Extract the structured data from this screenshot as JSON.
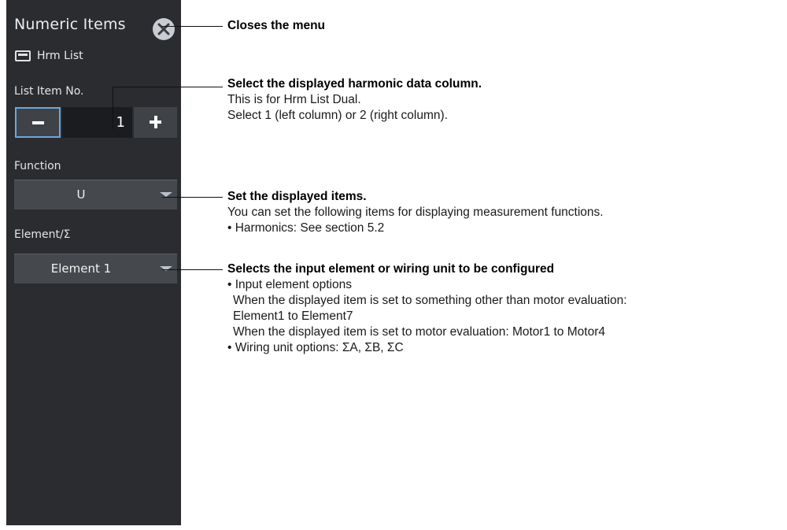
{
  "panel": {
    "title": "Numeric Items",
    "mode_label": "Hrm List",
    "list_item_label": "List Item No.",
    "list_item_value": "1",
    "function_label": "Function",
    "function_value": "U",
    "element_label": "Element/Σ",
    "element_value": "Element 1"
  },
  "annotations": {
    "close": {
      "heading": "Closes the menu"
    },
    "list_item": {
      "heading": "Select the displayed harmonic data column.",
      "lines": [
        "This is for Hrm List Dual.",
        "Select 1 (left column) or 2 (right column)."
      ]
    },
    "function": {
      "heading": "Set the displayed items.",
      "lines": [
        "You can set the following items for displaying measurement functions.",
        "• Harmonics: See section 5.2"
      ]
    },
    "element": {
      "heading": "Selects the input element or wiring unit to be configured",
      "lines": [
        "• Input element options",
        "When the displayed item is set to something other than motor evaluation:",
        "Element1 to Element7",
        "When the displayed item is set to motor evaluation: Motor1 to Motor4",
        "• Wiring unit options: ΣA, ΣB, ΣC"
      ]
    }
  },
  "icons": {
    "close": "close-icon",
    "mode": "list-display-icon",
    "minus": "minus-icon",
    "plus": "plus-icon",
    "dropdown": "chevron-down-icon"
  },
  "colors": {
    "panel_bg": "#2a2c30",
    "selected_border": "#6aa7dc",
    "close_button": "#c9cdd2"
  }
}
